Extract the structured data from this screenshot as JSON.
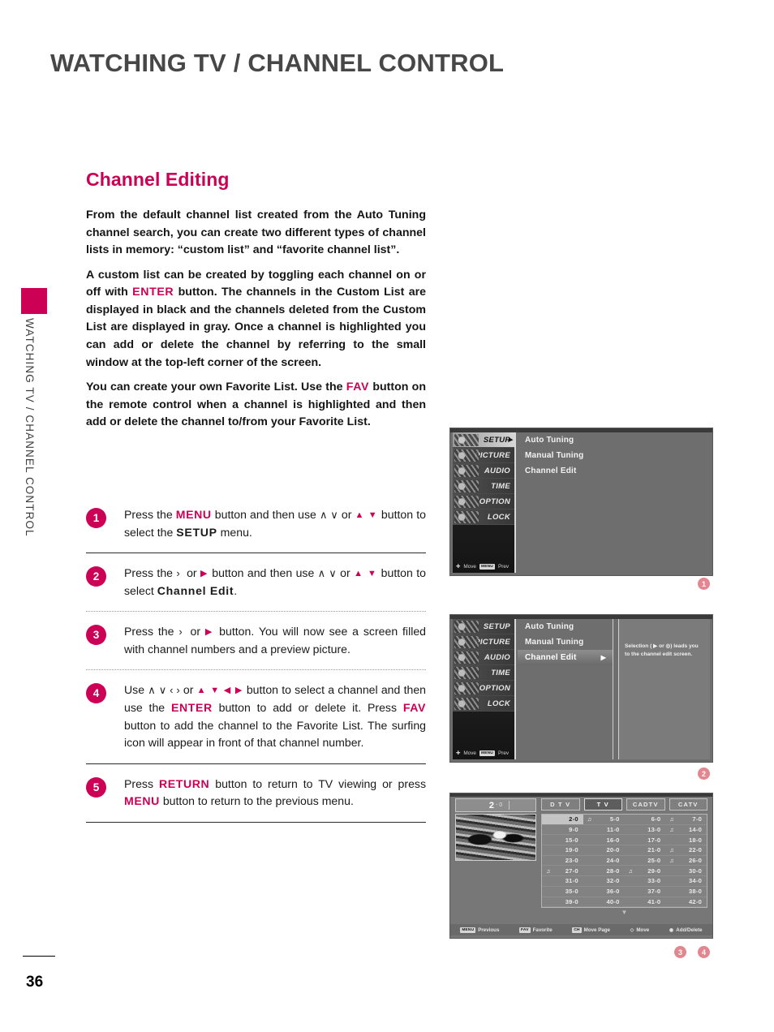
{
  "page": {
    "chapter_title": "WATCHING TV / CHANNEL CONTROL",
    "side_tab_text": "WATCHING TV / CHANNEL CONTROL",
    "page_number": "36",
    "section_title": "Channel Editing"
  },
  "intro": {
    "p1_a": "From the default channel list created from the Auto Tuning channel search, you can create two different types of channel lists in memory: “custom list” and “favorite channel list”.",
    "p2_a": "A custom list can be created by toggling each channel on or off with ",
    "p2_kw": "ENTER",
    "p2_b": " button. The channels in the Custom List are displayed in black and the channels deleted from the Custom List are displayed in gray. Once a channel is highlighted you can add or delete the channel by referring to the small window at the top-left corner of the screen.",
    "p3_a": "You can create your own Favorite List. Use the ",
    "p3_kw": "FAV",
    "p3_b": " button on the remote control when a channel is highlighted and then add or delete the channel to/from your Favorite List."
  },
  "steps": [
    {
      "number": "1",
      "a": "Press the ",
      "kw1": "MENU",
      "b": " button and then use ",
      "arrows1": "∧ ∨",
      "or": " or ",
      "arrows2": "▲ ▼",
      "c": " button to select the ",
      "bold": "SETUP",
      "d": " menu."
    },
    {
      "number": "2",
      "a": "Press the ",
      "chev": "›",
      "or": " or ",
      "arrow_r": "▶",
      "b": " button and then use ",
      "arrows1": "∧ ∨",
      "or2": " or ",
      "arrows2": "▲ ▼",
      "c": " button to select ",
      "bold": "Channel Edit",
      "d": "."
    },
    {
      "number": "3",
      "a": "Press the ",
      "chev": "›",
      "or": " or ",
      "arrow_r": "▶",
      "b": " button. You will now see a screen filled with channel numbers and a preview picture."
    },
    {
      "number": "4",
      "a": "Use ",
      "arrows1": "∧ ∨ ‹ ›",
      "or": " or ",
      "arrows2": "▲ ▼ ◀ ▶",
      "b": " button to select a channel and then use the ",
      "kw1": "ENTER",
      "c": " button  to add or delete it. Press ",
      "kw2": "FAV",
      "d": " button to add the channel to the Favorite List. The surfing icon will appear in front of that channel number."
    },
    {
      "number": "5",
      "a": "Press ",
      "kw1": "RETURN",
      "b": " button to return to TV viewing or press ",
      "kw2": "MENU",
      "c": " button to return to the previous menu."
    }
  ],
  "tv_menu": {
    "left_items": [
      {
        "label": "SETUP",
        "selected": true
      },
      {
        "label": "PICTURE",
        "selected": false
      },
      {
        "label": "AUDIO",
        "selected": false
      },
      {
        "label": "TIME",
        "selected": false
      },
      {
        "label": "OPTION",
        "selected": false
      },
      {
        "label": "LOCK",
        "selected": false
      }
    ],
    "foot_move": "Move",
    "foot_prev_key": "MENU",
    "foot_prev": "Prev",
    "options": [
      {
        "label": "Auto Tuning"
      },
      {
        "label": "Manual Tuning"
      },
      {
        "label": "Channel Edit"
      }
    ],
    "help_text": "Selection ( ▶ or ◎) leads you to the channel edit screen."
  },
  "channel_edit": {
    "current_channel": "2",
    "current_sub": "- 0",
    "tabs": [
      {
        "label": "D T V",
        "active": false
      },
      {
        "label": "T V",
        "active": true
      },
      {
        "label": "CADTV",
        "active": false
      },
      {
        "label": "CATV",
        "active": false
      }
    ],
    "rows": [
      [
        {
          "ch": "2-0",
          "surf": false,
          "sel": true
        },
        {
          "ch": "5-0",
          "surf": true,
          "sel": false
        },
        {
          "ch": "6-0",
          "surf": false,
          "sel": false
        },
        {
          "ch": "7-0",
          "surf": true,
          "sel": false
        }
      ],
      [
        {
          "ch": "9-0",
          "surf": false,
          "sel": false
        },
        {
          "ch": "11-0",
          "surf": false,
          "sel": false
        },
        {
          "ch": "13-0",
          "surf": false,
          "sel": false
        },
        {
          "ch": "14-0",
          "surf": true,
          "sel": false
        }
      ],
      [
        {
          "ch": "15-0",
          "surf": false,
          "sel": false
        },
        {
          "ch": "16-0",
          "surf": false,
          "sel": false
        },
        {
          "ch": "17-0",
          "surf": false,
          "sel": false
        },
        {
          "ch": "18-0",
          "surf": false,
          "sel": false
        }
      ],
      [
        {
          "ch": "19-0",
          "surf": false,
          "sel": false
        },
        {
          "ch": "20-0",
          "surf": false,
          "sel": false
        },
        {
          "ch": "21-0",
          "surf": false,
          "sel": false
        },
        {
          "ch": "22-0",
          "surf": true,
          "sel": false
        }
      ],
      [
        {
          "ch": "23-0",
          "surf": false,
          "sel": false
        },
        {
          "ch": "24-0",
          "surf": false,
          "sel": false
        },
        {
          "ch": "25-0",
          "surf": false,
          "sel": false
        },
        {
          "ch": "26-0",
          "surf": true,
          "sel": false
        }
      ],
      [
        {
          "ch": "27-0",
          "surf": true,
          "sel": false
        },
        {
          "ch": "28-0",
          "surf": false,
          "sel": false
        },
        {
          "ch": "29-0",
          "surf": true,
          "sel": false
        },
        {
          "ch": "30-0",
          "surf": false,
          "sel": false
        }
      ],
      [
        {
          "ch": "31-0",
          "surf": false,
          "sel": false
        },
        {
          "ch": "32-0",
          "surf": false,
          "sel": false
        },
        {
          "ch": "33-0",
          "surf": false,
          "sel": false
        },
        {
          "ch": "34-0",
          "surf": false,
          "sel": false
        }
      ],
      [
        {
          "ch": "35-0",
          "surf": false,
          "sel": false
        },
        {
          "ch": "36-0",
          "surf": false,
          "sel": false
        },
        {
          "ch": "37-0",
          "surf": false,
          "sel": false
        },
        {
          "ch": "38-0",
          "surf": false,
          "sel": false
        }
      ],
      [
        {
          "ch": "39-0",
          "surf": false,
          "sel": false
        },
        {
          "ch": "40-0",
          "surf": false,
          "sel": false
        },
        {
          "ch": "41-0",
          "surf": false,
          "sel": false
        },
        {
          "ch": "42-0",
          "surf": false,
          "sel": false
        }
      ]
    ],
    "footer": [
      {
        "key": "MENU",
        "label": "Previous"
      },
      {
        "key": "FAV",
        "label": "Favorite"
      },
      {
        "key": "CH",
        "label": "Move Page"
      },
      {
        "key": "◇",
        "label": "Move"
      },
      {
        "key": "◉",
        "label": "Add/Delete"
      }
    ]
  },
  "callouts": [
    {
      "n": "1"
    },
    {
      "n": "2"
    },
    {
      "n": "3"
    },
    {
      "n": "4"
    }
  ],
  "colors": {
    "accent": "#cc0055",
    "title_gray": "#474747",
    "callout_pink": "#e2868f"
  }
}
